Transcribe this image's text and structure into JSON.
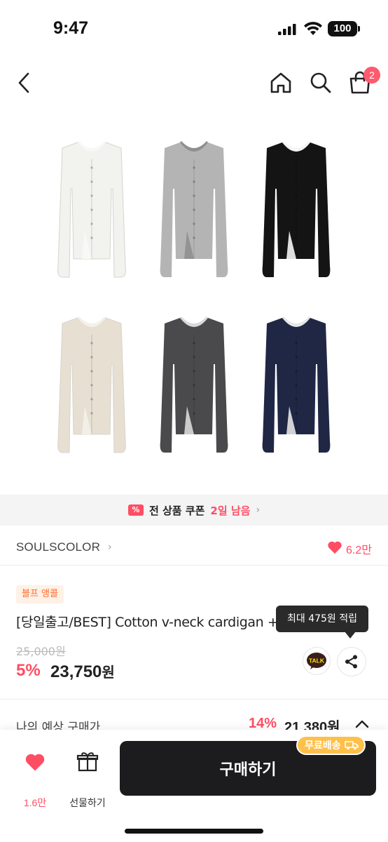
{
  "status_bar": {
    "time": "9:47",
    "battery": "100"
  },
  "nav": {
    "back_icon": "chevron-left-icon",
    "home_icon": "home-icon",
    "search_icon": "search-icon",
    "cart_icon": "shopping-bag-icon",
    "cart_count": "2"
  },
  "product_image": {
    "garments": [
      {
        "color_name": "white",
        "color": "#f2f2ef",
        "inner": "#f8f8f6"
      },
      {
        "color_name": "gray",
        "color": "#b4b4b4",
        "inner": "#8f8f8f"
      },
      {
        "color_name": "black",
        "color": "#141414",
        "inner": "#f5f5f5"
      },
      {
        "color_name": "beige",
        "color": "#e6dfd2",
        "inner": "#f4f1ea"
      },
      {
        "color_name": "charcoal",
        "color": "#4a4a4c",
        "inner": "#d9d9d9"
      },
      {
        "color_name": "navy",
        "color": "#1f2744",
        "inner": "#e6e6e6"
      }
    ]
  },
  "coupon": {
    "icon": "coupon-icon",
    "icon_text": "%",
    "text": "전 상품 쿠폰",
    "days_left": "2일 남음",
    "arrow": "›"
  },
  "brand": {
    "name": "SOULSCOLOR",
    "arrow": "›",
    "like_count": "6.2만"
  },
  "product": {
    "tag": "블프 앵콜",
    "title": "[당일출고/BEST] Cotton v-neck cardigan + (00000)",
    "original_price": "25,000원",
    "discount_rate": "5%",
    "sale_price": "23,750",
    "sale_price_unit": "원",
    "points_tooltip": "최대 475원 적립",
    "kakao_label": "TALK"
  },
  "expected": {
    "label": "나의 예상 구매가",
    "rate": "14%",
    "price": "21,380원"
  },
  "bottom_bar": {
    "wish_count": "1.6만",
    "gift_label": "선물하기",
    "buy_label": "구매하기",
    "free_shipping": "무료배송"
  },
  "colors": {
    "accent": "#ff4d64",
    "buy_button": "#1c1c1e",
    "free_shipping": "#ffc04a"
  }
}
